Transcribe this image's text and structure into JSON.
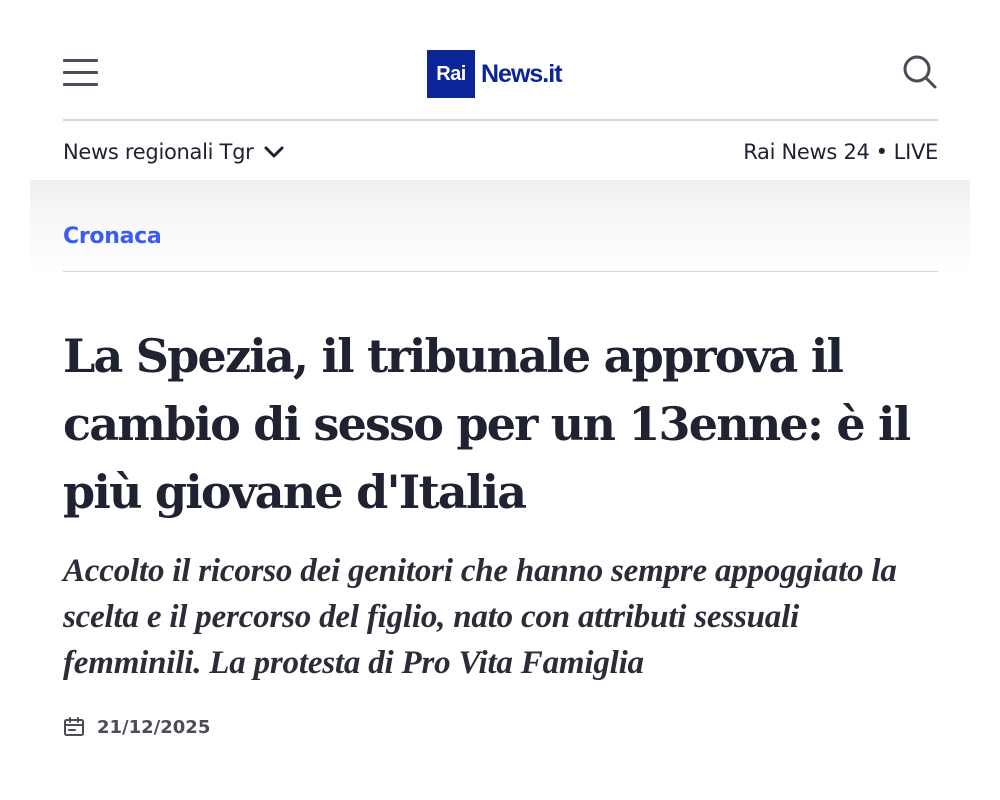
{
  "header": {
    "logo": {
      "rai_text": "Rai",
      "news_text": "News.it",
      "brand_color": "#0b2497"
    },
    "menu_icon": "hamburger-menu-icon",
    "search_icon": "search-icon",
    "regional_nav_label": "News regionali Tgr",
    "live": {
      "channel": "Rai News 24",
      "separator": "•",
      "label": "LIVE"
    }
  },
  "article": {
    "category": "Cronaca",
    "category_color": "#3a5cf0",
    "headline": "La Spezia, il tribunale approva il cambio di sesso per un 13enne: è il più giovane d'Italia",
    "subtitle": "Accolto il ricorso dei genitori che hanno sempre appoggiato la scelta e il percorso del figlio, nato con attributi sessuali femminili. La protesta di Pro Vita Famiglia",
    "date": "21/12/2025",
    "date_icon": "calendar-icon"
  }
}
